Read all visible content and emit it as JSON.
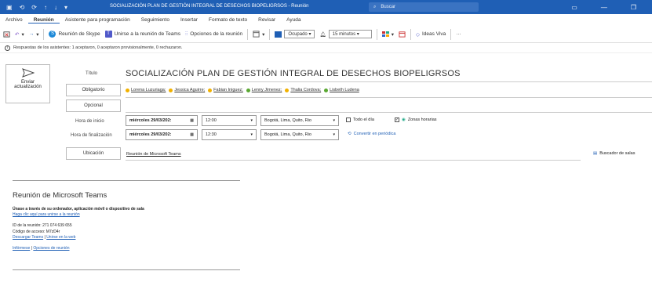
{
  "titlebar": {
    "doc_title": "SOCIALIZACIÓN PLAN DE GESTIÓN INTEGRAL DE DESECHOS BIOPELIGRSOS  -  Reunión",
    "search_placeholder": "Buscar"
  },
  "menu": {
    "tabs": [
      "Archivo",
      "Reunión",
      "Asistente para programación",
      "Seguimiento",
      "Insertar",
      "Formato de texto",
      "Revisar",
      "Ayuda"
    ]
  },
  "ribbon": {
    "skype_label": "Reunión de Skype",
    "teams_label": "Unirse a la reunión de Teams",
    "options_label": "Opciones de la reunión",
    "busy_label": "Ocupado",
    "reminder_label": "15 minutos",
    "ideas_label": "Ideas Viva",
    "more_label": "···"
  },
  "info": {
    "text": "Respuestas de los asistentes: 1 aceptaron, 0 aceptaron provisionalmente, 0 rechazaron."
  },
  "form": {
    "send_label_1": "Enviar",
    "send_label_2": "actualización",
    "title_label": "Título",
    "subject": "SOCIALIZACIÓN PLAN DE GESTIÓN INTEGRAL DE DESECHOS BIOPELIGRSOS",
    "required_label": "Obligatorio",
    "optional_label": "Opcional",
    "attendees": [
      {
        "name": "Lorena Luzuriaga;",
        "color": "#f2b100"
      },
      {
        "name": "Jessica Aguirre;",
        "color": "#f2b100"
      },
      {
        "name": "Fabian Iniguez;",
        "color": "#f2b100"
      },
      {
        "name": "Lenny Jimenez;",
        "color": "#5aa832"
      },
      {
        "name": "Thalia Cordova;",
        "color": "#f2b100"
      },
      {
        "name": "Lisbeth Ludena",
        "color": "#5aa832"
      }
    ],
    "start_label": "Hora de inicio",
    "start_date": "miércoles 29/03/202:",
    "start_time": "12:00",
    "start_tz": "Bogotá, Lima, Quito, Rio",
    "allday_label": "Todo el día",
    "zones_label": "Zonas horarias",
    "end_label": "Hora de finalización",
    "end_date": "miércoles 29/03/202:",
    "end_time": "12:30",
    "end_tz": "Bogotá, Lima, Quito, Rio",
    "recurring_label": "Convertir en periódica",
    "location_button": "Ubicación",
    "location_value": "Reunión de Microsoft Teams",
    "room_finder": "Buscador de salas"
  },
  "body": {
    "teams_title": "Reunión de Microsoft Teams",
    "join_heading": "Únase a través de su ordenador, aplicación móvil o dispositivo de sala",
    "join_link": "Haga clic aquí para unirse a la reunión",
    "meeting_id": "ID de la reunión: 271 074 639 655",
    "passcode": "Código de acceso: M7zD4r",
    "download_teams": "Descargar Teams",
    "join_web": "Unirse en la web",
    "learn_more": "Infórmese",
    "meeting_options": "Opciones de reunión",
    "pipe": "|"
  },
  "colors": {
    "accent": "#1f5fb5"
  }
}
